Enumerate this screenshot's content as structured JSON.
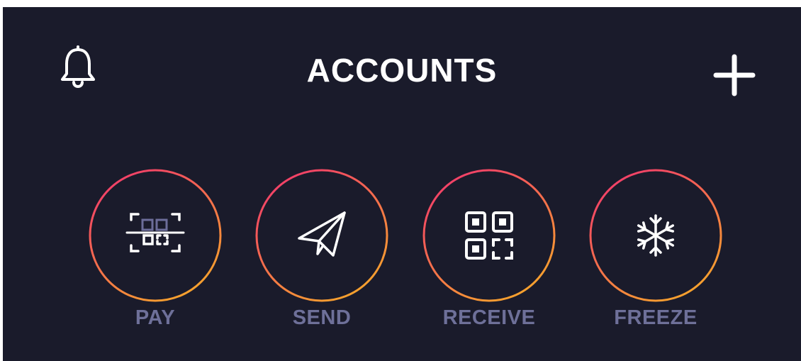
{
  "header": {
    "title": "ACCOUNTS",
    "left_icon": "bell-icon",
    "right_icon": "plus-icon"
  },
  "actions": [
    {
      "label": "PAY",
      "icon": "scan-qr-icon"
    },
    {
      "label": "SEND",
      "icon": "paper-plane-icon"
    },
    {
      "label": "RECEIVE",
      "icon": "qr-code-icon"
    },
    {
      "label": "FREEZE",
      "icon": "snowflake-icon"
    }
  ],
  "colors": {
    "background": "#1a1b2b",
    "ring_gradient_start": "#f23b6b",
    "ring_gradient_end": "#f7a72a",
    "label": "#6e7099",
    "text": "#ffffff"
  }
}
